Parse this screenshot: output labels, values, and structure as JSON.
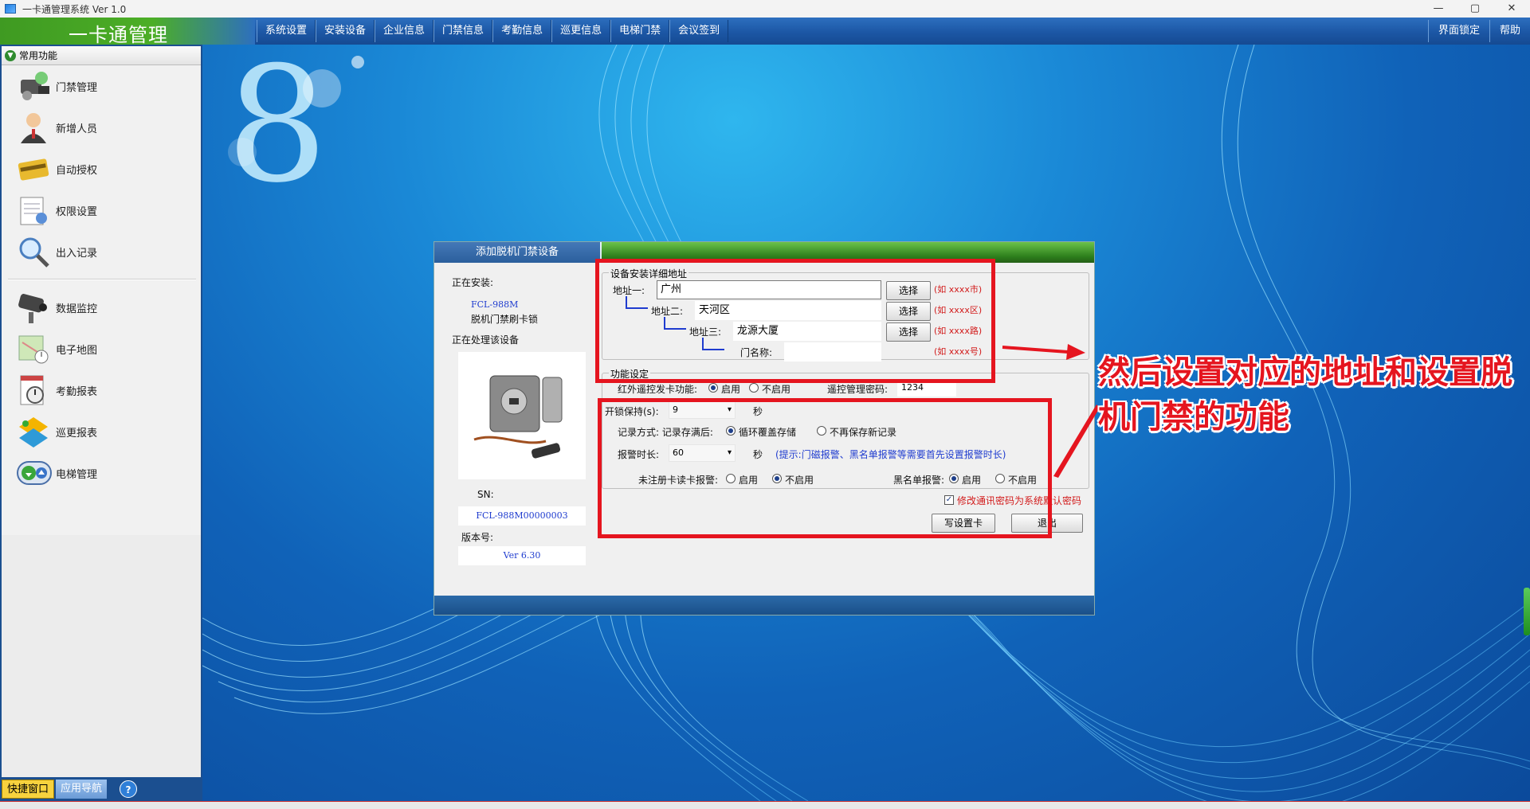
{
  "window": {
    "title": "一卡通管理系统 Ver 1.0",
    "controls": [
      "—",
      "▢",
      "✕"
    ]
  },
  "header": {
    "brand": "一卡通管理",
    "menus": [
      "系统设置",
      "安装设备",
      "企业信息",
      "门禁信息",
      "考勤信息",
      "巡更信息",
      "电梯门禁",
      "会议签到"
    ],
    "right_menus": [
      "界面锁定",
      "帮助"
    ]
  },
  "sidebar": {
    "header": "常用功能",
    "items": [
      {
        "label": "门禁管理",
        "icon": "door-access-icon"
      },
      {
        "label": "新增人员",
        "icon": "person-add-icon"
      },
      {
        "label": "自动授权",
        "icon": "card-auth-icon"
      },
      {
        "label": "权限设置",
        "icon": "permission-doc-icon"
      },
      {
        "label": "出入记录",
        "icon": "magnifier-record-icon"
      },
      {
        "label": "数据监控",
        "icon": "camera-monitor-icon"
      },
      {
        "label": "电子地图",
        "icon": "map-icon"
      },
      {
        "label": "考勤报表",
        "icon": "clock-report-icon"
      },
      {
        "label": "巡更报表",
        "icon": "patrol-report-icon"
      },
      {
        "label": "电梯管理",
        "icon": "elevator-icon"
      }
    ],
    "bottom_tabs": [
      "快捷窗口",
      "应用导航"
    ],
    "help_label": "?"
  },
  "dialog": {
    "tab_title": "添加脱机门禁设备",
    "left": {
      "installing_label": "正在安装:",
      "model": "FCL-988M",
      "device_name": "脱机门禁刷卡锁",
      "processing_label": "正在处理该设备",
      "sn_label": "SN:",
      "sn_value": "FCL-988M00000003",
      "version_label": "版本号:",
      "version_value": "Ver 6.30"
    },
    "address": {
      "group_title": "设备安装详细地址",
      "addr1_label": "地址一:",
      "addr1_value": "广州",
      "addr2_label": "地址二:",
      "addr2_value": "天河区",
      "addr3_label": "地址三:",
      "addr3_value": "龙源大厦",
      "door_label": "门名称:",
      "door_value": "",
      "select_label": "选择",
      "hint1": "(如 xxxx市)",
      "hint2": "(如 xxxx区)",
      "hint3": "(如 xxxx路)",
      "hint4": "(如 xxxx号)"
    },
    "function": {
      "group_title": "功能设定",
      "ir_label": "红外遥控发卡功能:",
      "enable": "启用",
      "disable": "不启用",
      "remote_pwd_label": "遥控管理密码:",
      "remote_pwd_value": "1234",
      "unlock_label": "开锁保持(s):",
      "unlock_value": "9",
      "sec": "秒",
      "record_label": "记录方式: 记录存满后:",
      "record_opt1": "循环覆盖存储",
      "record_opt2": "不再保存新记录",
      "alarm_label": "报警时长:",
      "alarm_value": "60",
      "alarm_tip": "(提示:门磁报警、黑名单报警等需要首先设置报警时长)",
      "unreg_label": "未注册卡读卡报警:",
      "blacklist_label": "黑名单报警:"
    },
    "default_pwd_label": "修改通讯密码为系统默认密码",
    "write_btn": "写设置卡",
    "exit_btn": "退出"
  },
  "annotation": "然后设置对应的地址和设置脱机门禁的功能",
  "colors": {
    "highlight_red": "#e5151f",
    "brand_green": "#4cae26",
    "header_blue": "#1c57a5"
  }
}
